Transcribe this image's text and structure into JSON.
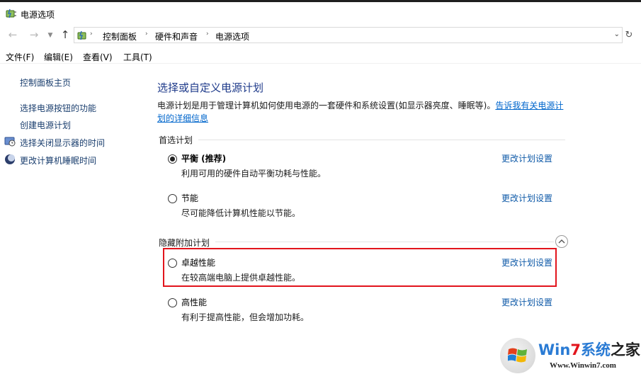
{
  "window": {
    "title": "电源选项"
  },
  "address": {
    "crumbs": [
      "控制面板",
      "硬件和声音",
      "电源选项"
    ],
    "back_icon": "arrow-left-icon",
    "forward_icon": "arrow-right-icon",
    "up_icon": "arrow-up-icon",
    "refresh_icon": "refresh-icon"
  },
  "menu": [
    "文件(F)",
    "编辑(E)",
    "查看(V)",
    "工具(T)"
  ],
  "sidebar": {
    "home": "控制面板主页",
    "links": [
      "选择电源按钮的功能",
      "创建电源计划",
      "选择关闭显示器的时间",
      "更改计算机睡眠时间"
    ]
  },
  "main": {
    "heading": "选择或自定义电源计划",
    "description": "电源计划是用于管理计算机如何使用电源的一套硬件和系统设置(如显示器亮度、睡眠等)。",
    "description_link_1": "告诉我有关电源计",
    "description_link_2": "划的详细信息",
    "preferred_label": "首选计划",
    "hidden_label": "隐藏附加计划",
    "change_link": "更改计划设置",
    "plans": [
      {
        "name": "平衡 (推荐)",
        "desc": "利用可用的硬件自动平衡功耗与性能。",
        "selected": true
      },
      {
        "name": "节能",
        "desc": "尽可能降低计算机性能以节能。",
        "selected": false
      },
      {
        "name": "卓越性能",
        "desc": "在较高端电脑上提供卓越性能。",
        "selected": false
      },
      {
        "name": "高性能",
        "desc": "有利于提高性能，但会增加功耗。",
        "selected": false
      }
    ]
  },
  "watermark": {
    "logo_text": [
      "Win",
      "7",
      "系统",
      "之家"
    ],
    "url": "Www.Winwin7.com"
  },
  "colors": {
    "heading": "#1e3a8a",
    "link": "#0f5aa8",
    "highlight": "#e2141c"
  }
}
